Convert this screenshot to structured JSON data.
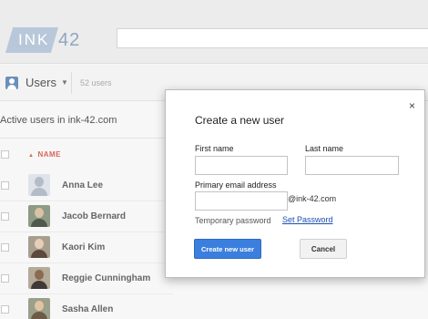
{
  "header": {
    "logo_text": "INK",
    "logo_number": "42",
    "search_value": ""
  },
  "toolbar": {
    "users_label": "Users",
    "user_count": "52 users"
  },
  "list": {
    "subheading": "Active users in ink-42.com",
    "name_column": "NAME",
    "rows": [
      {
        "name": "Anna Lee",
        "avatar": "placeholder-avatar"
      },
      {
        "name": "Jacob Bernard",
        "avatar": "photo-avatar"
      },
      {
        "name": "Kaori Kim",
        "avatar": "photo-avatar"
      },
      {
        "name": "Reggie Cunningham",
        "avatar": "photo-avatar"
      },
      {
        "name": "Sasha Allen",
        "avatar": "photo-avatar"
      }
    ]
  },
  "modal": {
    "title": "Create a new user",
    "close_icon": "×",
    "first_name_label": "First name",
    "first_name_value": "",
    "last_name_label": "Last name",
    "last_name_value": "",
    "email_label": "Primary email address",
    "email_value": "",
    "email_domain": "@ink-42.com",
    "temp_password_label": "Temporary password",
    "set_password_link": "Set Password",
    "create_button": "Create new user",
    "cancel_button": "Cancel"
  },
  "colors": {
    "accent": "#3b7fde",
    "link": "#1a4fb0",
    "sort_header": "#d9665c",
    "logo": "#b8c8da"
  }
}
